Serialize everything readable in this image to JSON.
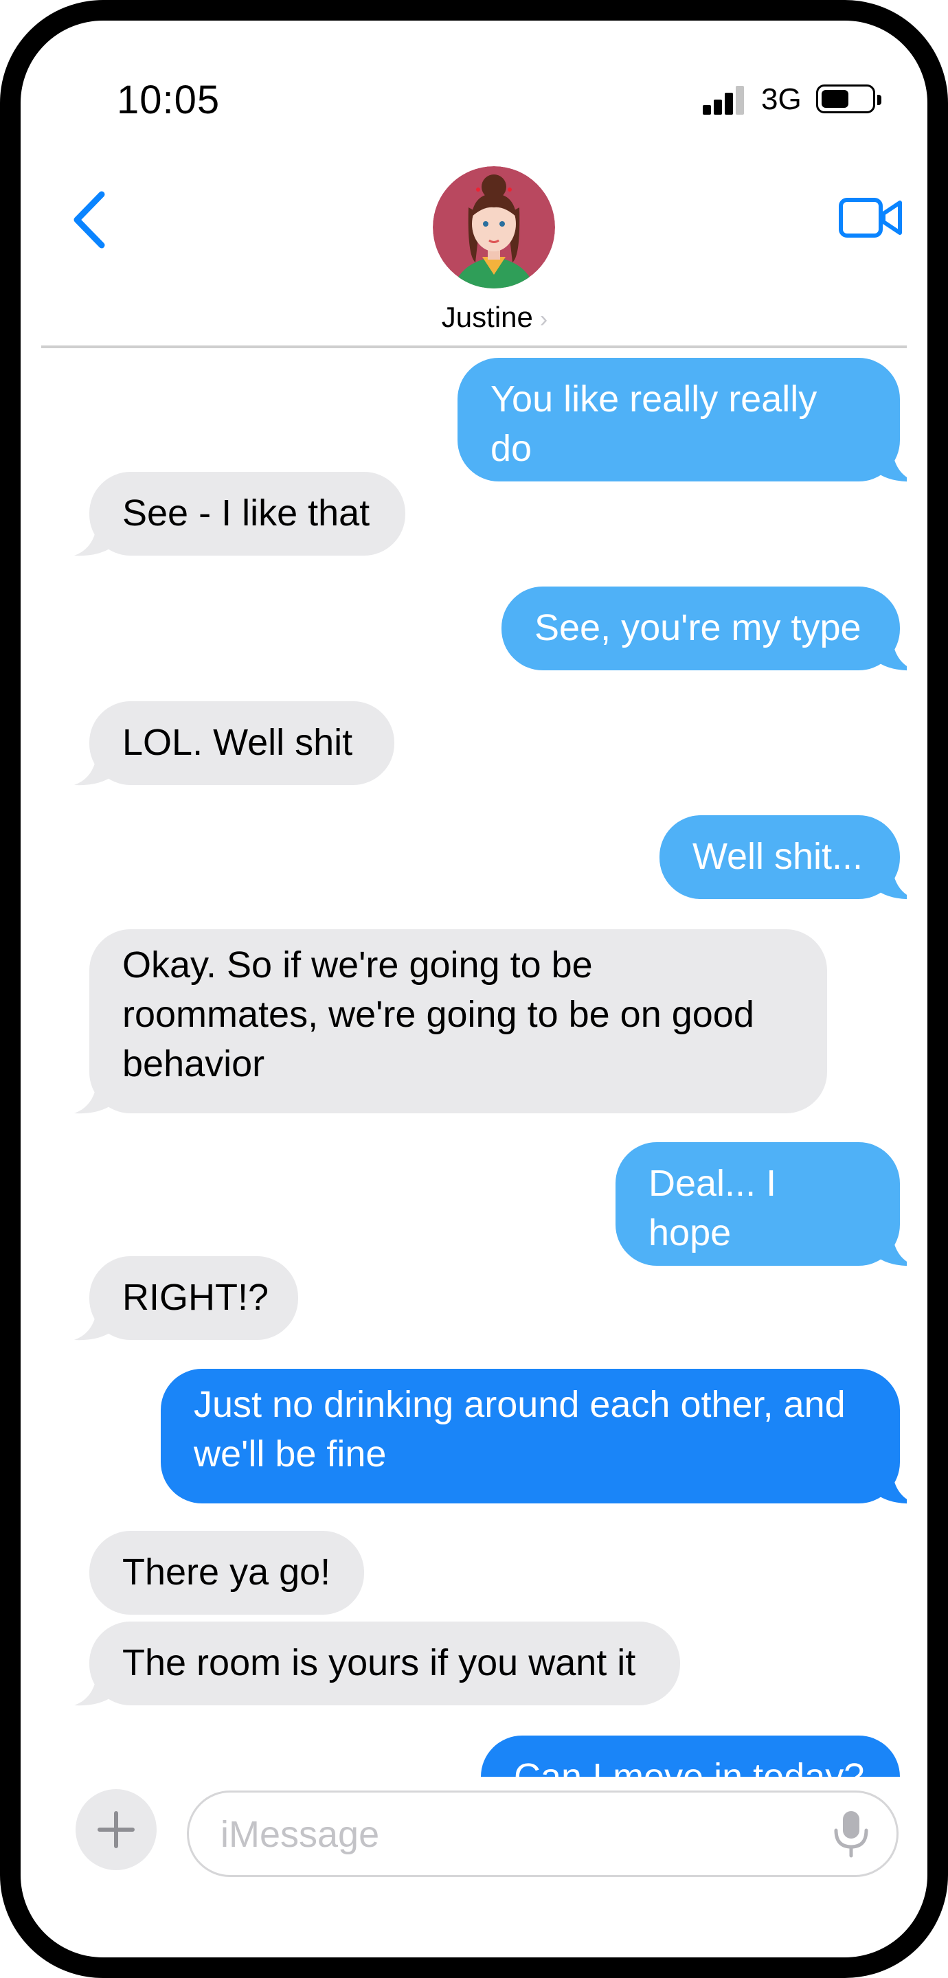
{
  "status_bar": {
    "time": "10:05",
    "network": "3G",
    "battery_level": 0.55
  },
  "header": {
    "contact_name": "Justine",
    "chevron": "›"
  },
  "colors": {
    "outgoing_bubble_top": "#4fb1f7",
    "outgoing_bubble_bottom": "#1a85f8",
    "incoming_bubble": "#e9e9eb",
    "accent": "#0a84ff",
    "avatar_bg": "#b9485f"
  },
  "messages": [
    {
      "dir": "out",
      "text": "You like really really do",
      "tail": true
    },
    {
      "dir": "in",
      "text": "See - I like that",
      "tail": true
    },
    {
      "dir": "out",
      "text": "See, you're my type",
      "tail": true
    },
    {
      "dir": "in",
      "text": "LOL.  Well shit",
      "tail": true
    },
    {
      "dir": "out",
      "text": "Well shit...",
      "tail": true
    },
    {
      "dir": "in",
      "text": "Okay.  So if we're going to be roommates, we're going to be on good behavior",
      "tail": true
    },
    {
      "dir": "out",
      "text": "Deal... I hope",
      "tail": true
    },
    {
      "dir": "in",
      "text": "RIGHT!?",
      "tail": true
    },
    {
      "dir": "out",
      "text": "Just no drinking around each other, and we'll be fine",
      "tail": true
    },
    {
      "dir": "in",
      "text": "There ya go!",
      "tail": false
    },
    {
      "dir": "in",
      "text": "The room is yours if you want it",
      "tail": true
    },
    {
      "dir": "out",
      "text": "Can I move in today?",
      "tail": true
    }
  ],
  "composer": {
    "placeholder": "iMessage"
  },
  "icons": {
    "back": "chevron-left-icon",
    "video": "video-camera-icon",
    "plus": "plus-icon",
    "mic": "microphone-icon"
  }
}
